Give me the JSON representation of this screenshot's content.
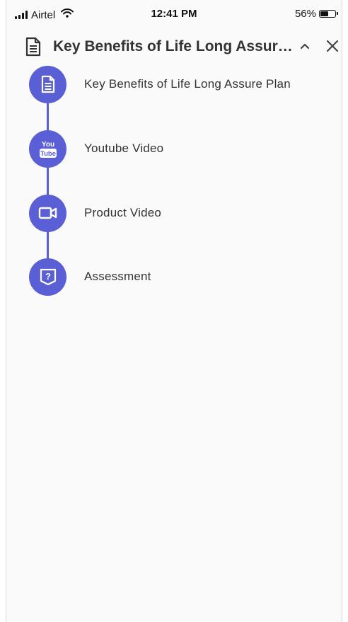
{
  "status_bar": {
    "carrier": "Airtel",
    "time": "12:41 PM",
    "battery_percent": "56%",
    "battery_level": 0.56
  },
  "header": {
    "title": "Key Benefits of Life Long Assure Plan",
    "icon": "document-icon",
    "collapse_icon": "chevron-up-icon",
    "close_icon": "close-icon"
  },
  "steps": [
    {
      "label": "Key Benefits of Life Long Assure Plan",
      "icon": "document-icon"
    },
    {
      "label": "Youtube Video",
      "icon": "youtube-icon",
      "icon_text_top": "You",
      "icon_text_bottom": "Tube"
    },
    {
      "label": "Product Video",
      "icon": "video-camera-icon"
    },
    {
      "label": "Assessment",
      "icon": "assessment-icon",
      "icon_text": "?"
    }
  ],
  "colors": {
    "accent": "#5a5fd6",
    "text": "#333333",
    "background": "#fafafa"
  }
}
